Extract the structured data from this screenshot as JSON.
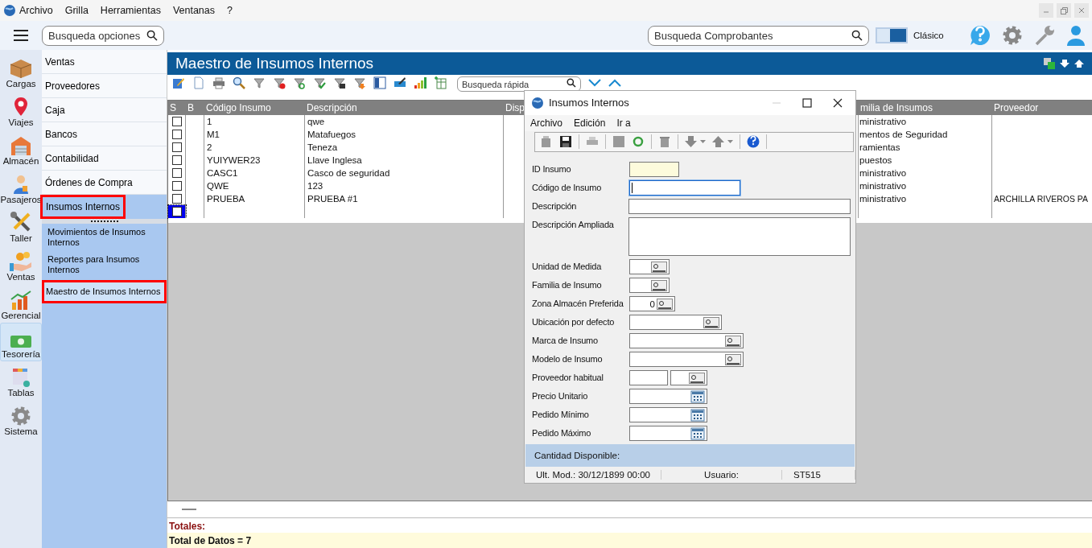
{
  "menu_bar": {
    "items": [
      "Archivo",
      "Grilla",
      "Herramientas",
      "Ventanas",
      "?"
    ]
  },
  "top_bar": {
    "options_search": {
      "placeholder": "Busqueda opciones"
    },
    "vouchers_search": {
      "placeholder": "Busqueda Comprobantes"
    },
    "view_toggle": {
      "on": true,
      "label": "Clásico"
    }
  },
  "modules": [
    {
      "label": "Cargas",
      "selected": false
    },
    {
      "label": "Viajes",
      "selected": false
    },
    {
      "label": "Almacén",
      "selected": false
    },
    {
      "label": "Pasajeros",
      "selected": false
    },
    {
      "label": "Taller",
      "selected": false
    },
    {
      "label": "Ventas",
      "selected": false
    },
    {
      "label": "Gerencial",
      "selected": false
    },
    {
      "label": "Tesorería",
      "selected": true
    },
    {
      "label": "Tablas",
      "selected": false
    },
    {
      "label": "Sistema",
      "selected": false
    }
  ],
  "module_menu": {
    "items": [
      {
        "label": "Ventas",
        "expanded": false,
        "highlighted": false
      },
      {
        "label": "Proveedores",
        "expanded": false,
        "highlighted": false
      },
      {
        "label": "Caja",
        "expanded": false,
        "highlighted": false
      },
      {
        "label": "Bancos",
        "expanded": false,
        "highlighted": false
      },
      {
        "label": "Contabilidad",
        "expanded": false,
        "highlighted": false
      },
      {
        "label": "Órdenes de Compra",
        "expanded": false,
        "highlighted": false
      },
      {
        "label": "Insumos Internos",
        "expanded": true,
        "highlighted": true,
        "children": [
          {
            "label": "Movimientos de Insumos Internos",
            "highlighted": false
          },
          {
            "label": "Reportes para Insumos Internos",
            "highlighted": false
          },
          {
            "label": "Maestro de Insumos Internos",
            "highlighted": true
          }
        ]
      }
    ]
  },
  "form": {
    "title": "Maestro de Insumos Internos",
    "quick_search": {
      "placeholder": "Busqueda rápida"
    }
  },
  "grid": {
    "columns": [
      "S",
      "B",
      "Código Insumo",
      "Descripción",
      "Disp",
      "milia de Insumos",
      "Proveedor"
    ],
    "rows": [
      {
        "selected": false,
        "checked": false,
        "code": "1",
        "description": "qwe",
        "family": "ministrativo"
      },
      {
        "selected": false,
        "checked": false,
        "code": "M1",
        "description": "Matafuegos",
        "family": "mentos de Seguridad"
      },
      {
        "selected": false,
        "checked": false,
        "code": "2",
        "description": "Teneza",
        "family": "ramientas"
      },
      {
        "selected": false,
        "checked": false,
        "code": "YUIYWER23",
        "description": "Llave Inglesa",
        "family": "puestos"
      },
      {
        "selected": false,
        "checked": false,
        "code": "CASC1",
        "description": "Casco de seguridad",
        "family": "ministrativo"
      },
      {
        "selected": false,
        "checked": false,
        "code": "QWE",
        "description": "123",
        "family": "ministrativo"
      },
      {
        "selected": false,
        "checked": false,
        "code": "PRUEBA",
        "description": "PRUEBA #1",
        "family": "ministrativo",
        "supplier": "ARCHILLA RIVEROS PA"
      },
      {
        "selected": true,
        "checked": false
      }
    ]
  },
  "totals": {
    "title": "Totales:",
    "count": "Total de Datos = 7"
  },
  "dialog": {
    "title": "Insumos Internos",
    "menu": [
      "Archivo",
      "Edición",
      "Ir a"
    ],
    "fields": [
      {
        "label": "ID Insumo",
        "kind": "id"
      },
      {
        "label": "Código de Insumo",
        "kind": "code",
        "focused": true
      },
      {
        "label": "Descripción",
        "kind": "text",
        "focused": false
      },
      {
        "label": "Descripción Ampliada",
        "kind": "memo"
      },
      {
        "label": "Unidad de Medida",
        "kind": "lookup"
      },
      {
        "label": "Familia de Insumo",
        "kind": "lookup"
      },
      {
        "label": "Zona Almacén Preferida",
        "kind": "zone",
        "value": "0"
      },
      {
        "label": "Ubicación por defecto",
        "kind": "location"
      },
      {
        "label": "Marca de Insumo",
        "kind": "wide"
      },
      {
        "label": "Modelo de Insumo",
        "kind": "wide"
      },
      {
        "label": "Proveedor habitual",
        "kind": "pair"
      },
      {
        "label": "Precio Unitario",
        "kind": "amount"
      },
      {
        "label": "Pedido Mínimo",
        "kind": "amount"
      },
      {
        "label": "Pedido Máximo",
        "kind": "amount"
      }
    ],
    "available_label": "Cantidad Disponible:",
    "status": [
      "Ult. Mod.: 30/12/1899 00:00",
      "Usuario:",
      "ST515"
    ]
  }
}
